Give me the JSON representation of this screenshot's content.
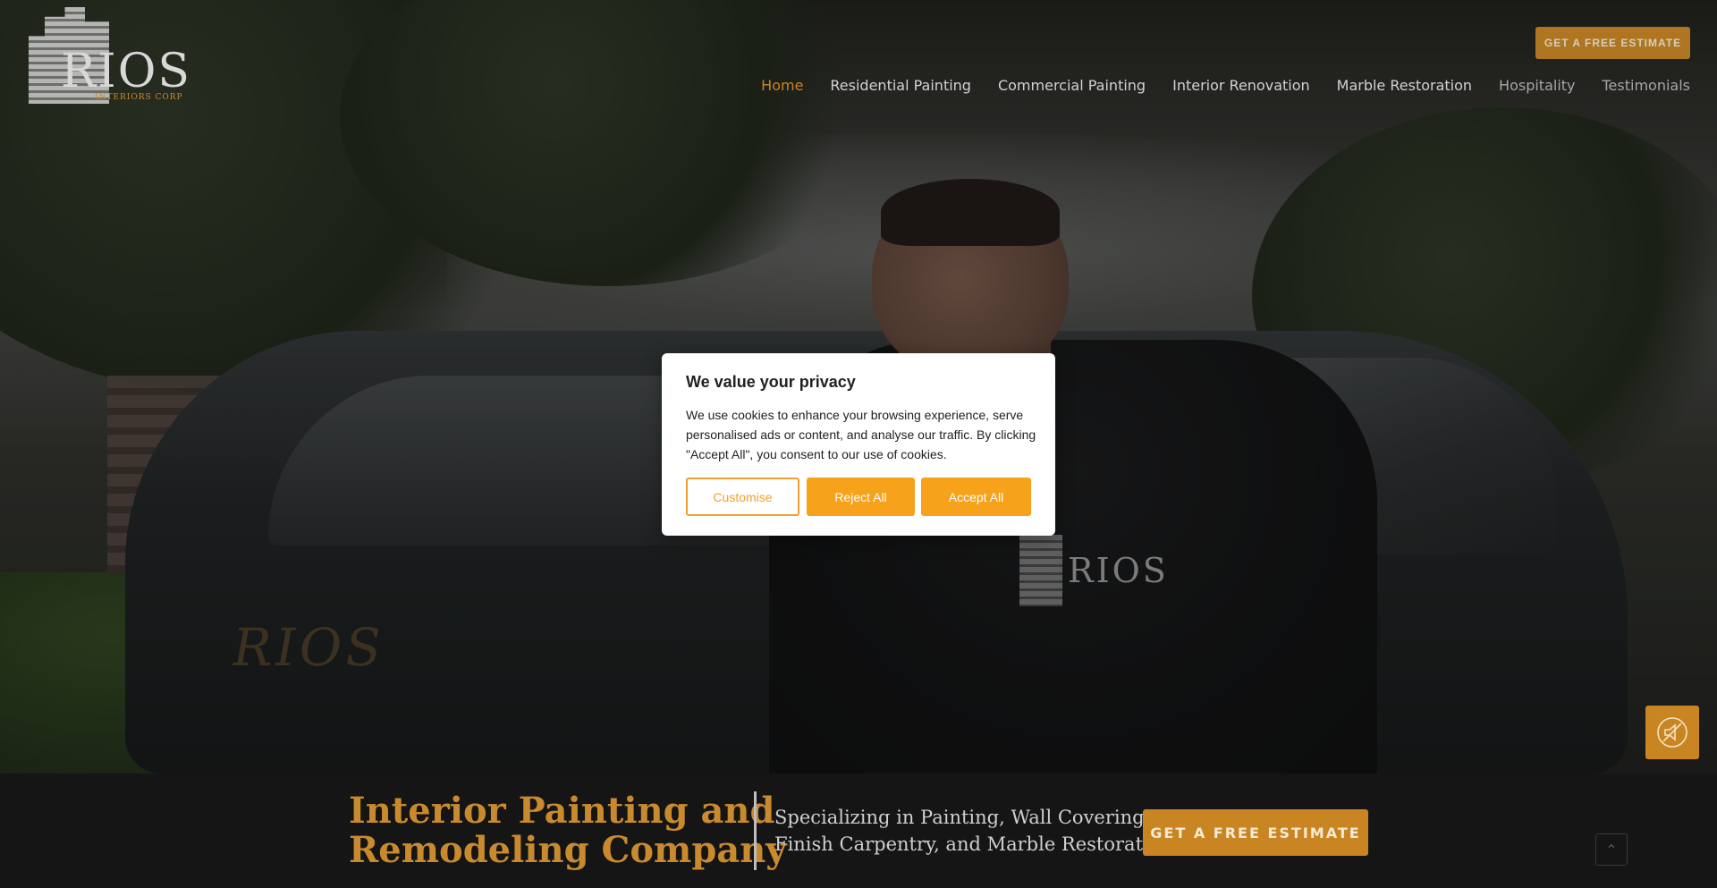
{
  "header": {
    "logo": {
      "word": "RIOS",
      "sub": "INTERIORS CORP"
    },
    "cta_label": "GET A FREE ESTIMATE",
    "nav": [
      {
        "label": "Home",
        "active": true
      },
      {
        "label": "Residential Painting"
      },
      {
        "label": "Commercial Painting"
      },
      {
        "label": "Interior Renovation"
      },
      {
        "label": "Marble Restoration"
      },
      {
        "label": "Hospitality"
      },
      {
        "label": "Testimonials"
      }
    ]
  },
  "cookie": {
    "title": "We value your privacy",
    "body": "We use cookies to enhance your browsing experience, serve personalised ads or content, and analyse our traffic. By clicking \"Accept All\", you consent to our use of cookies.",
    "customise_label": "Customise",
    "reject_label": "Reject All",
    "accept_label": "Accept All"
  },
  "hero": {
    "title_line1": "Interior Painting and",
    "title_line2": "Remodeling Company",
    "sub_line1": "Specializing in Painting, Wall Covering,",
    "sub_line2": "Finish Carpentry, and Marble Restoration.",
    "cta_label": "GET A FREE ESTIMATE",
    "scroll_icon": "chevron-up-icon",
    "mute_icon": "speaker-muted-icon"
  },
  "colors": {
    "accent": "#c98522",
    "cookie_button": "#f7a21b",
    "band_background": "#151515"
  }
}
